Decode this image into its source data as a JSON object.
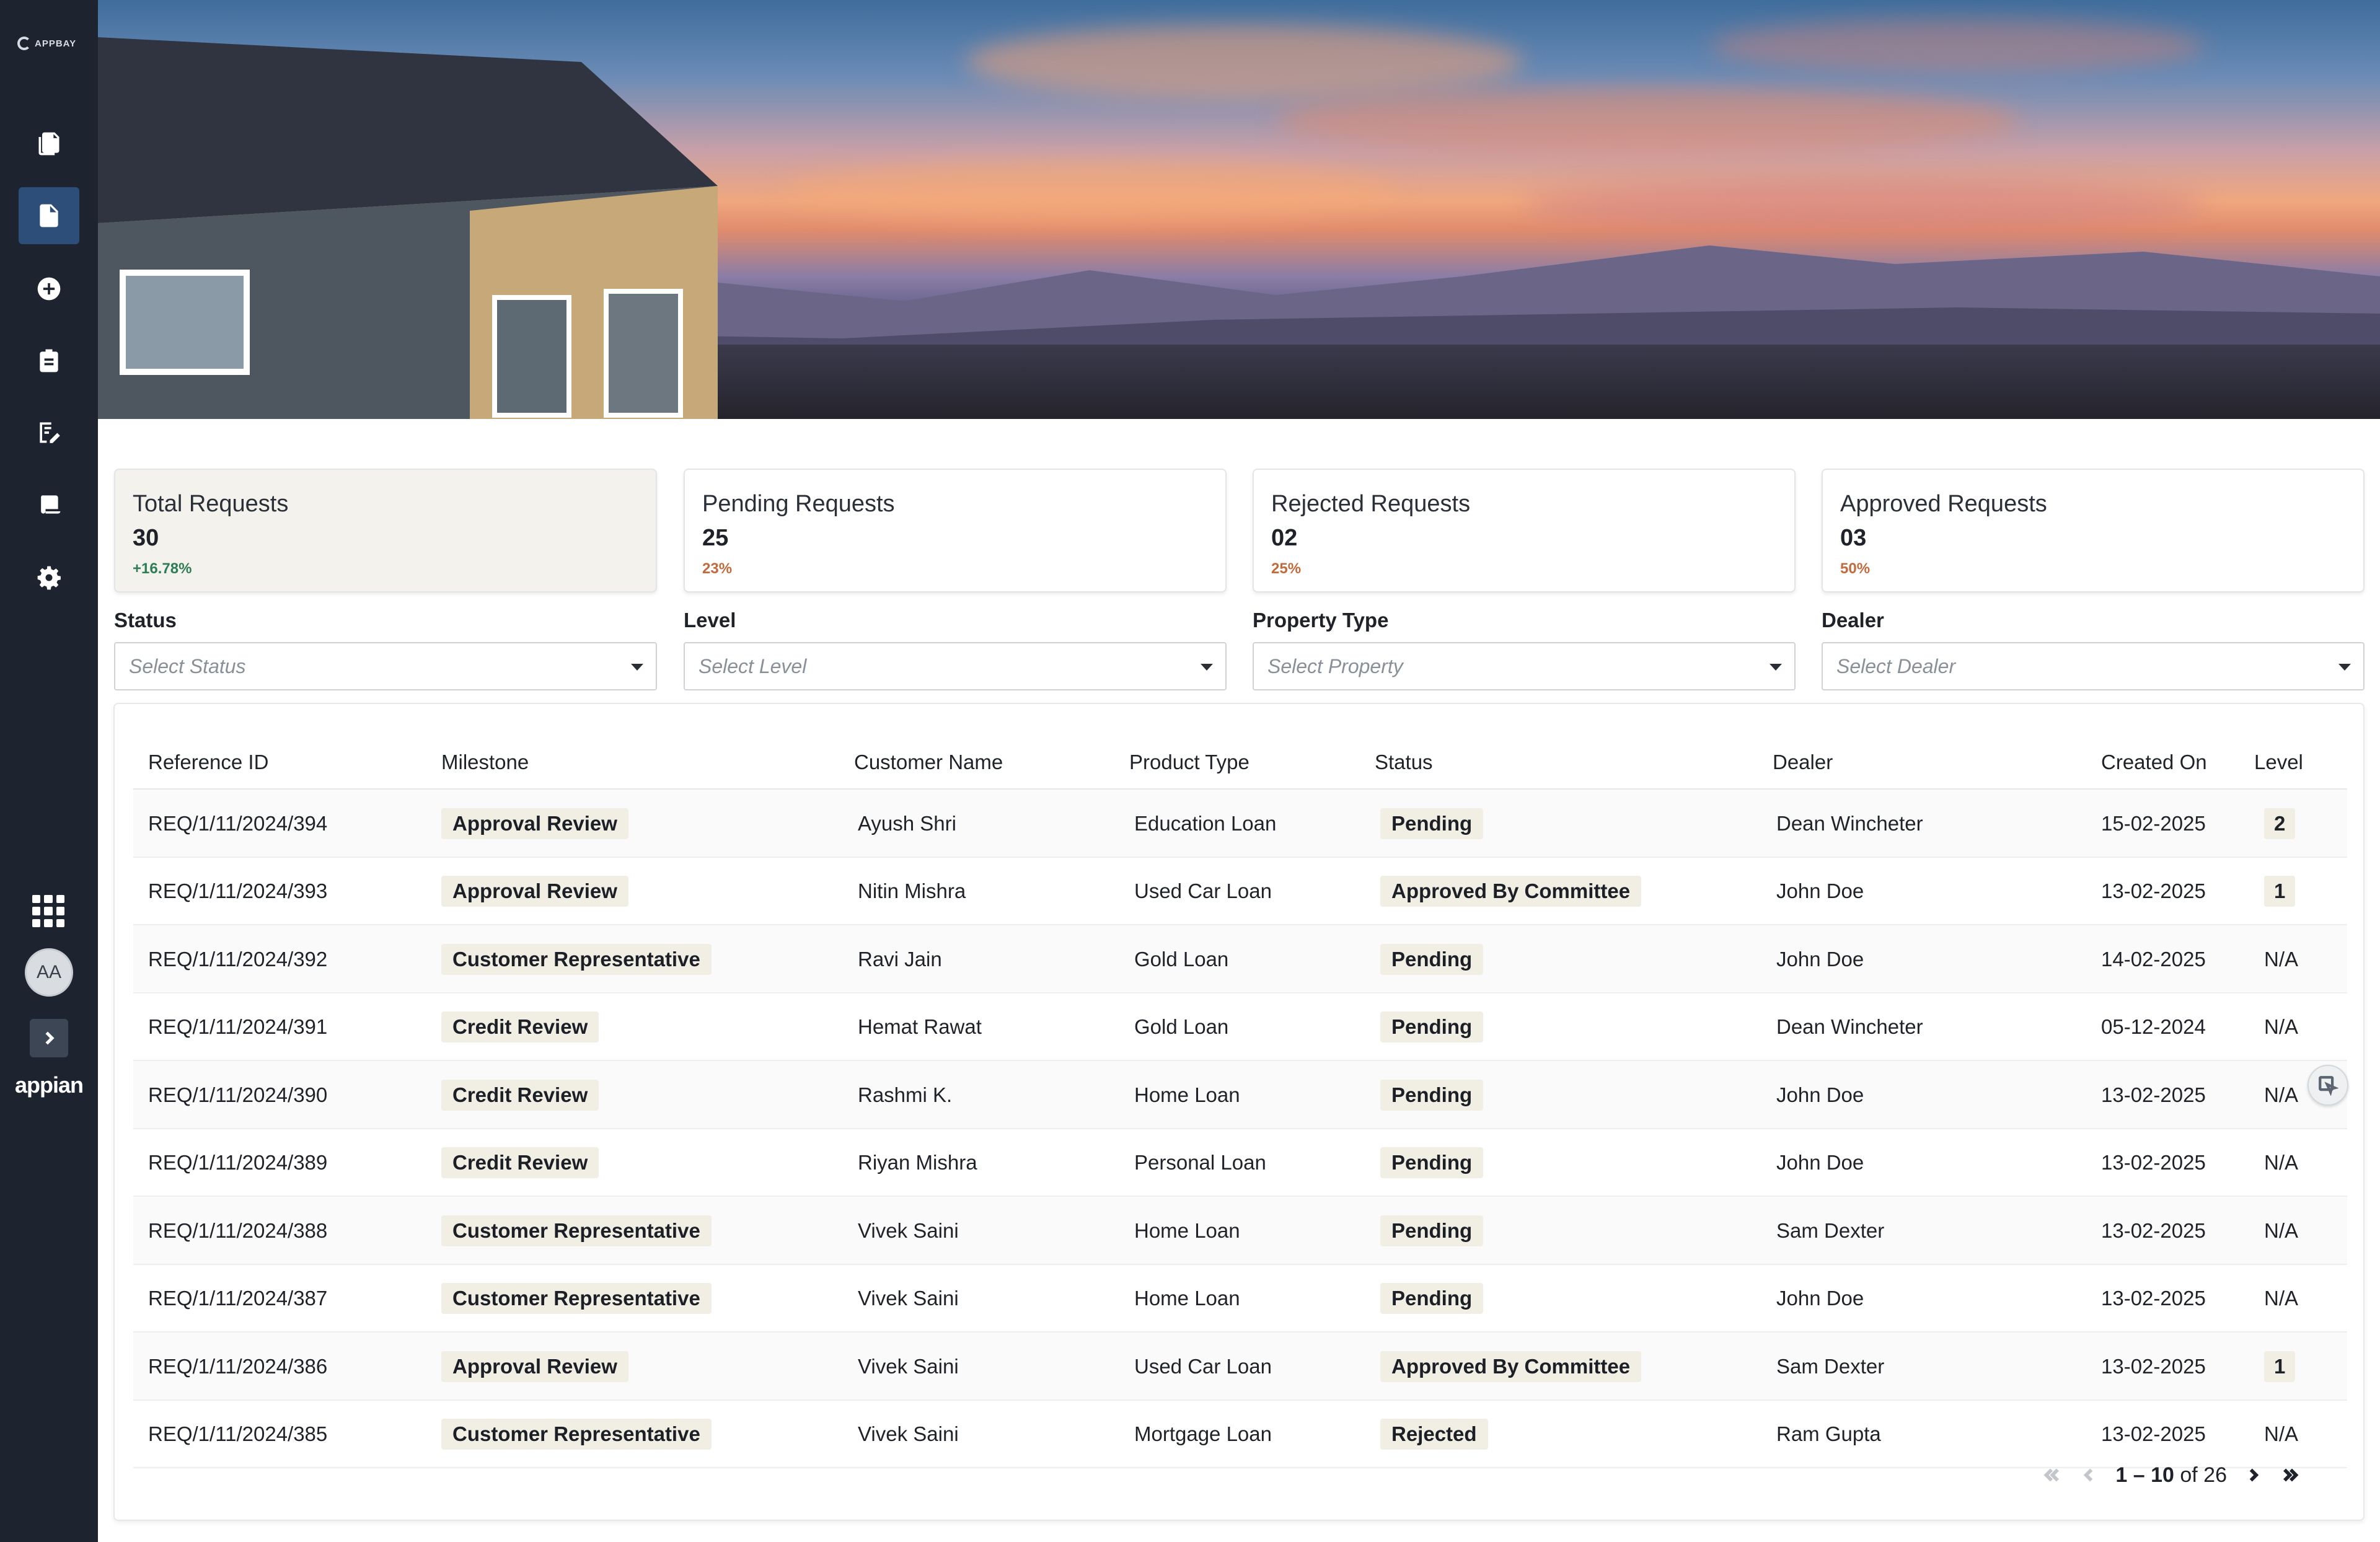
{
  "app": {
    "logo_text": "APPBAY",
    "brand": "appian",
    "avatar_initials": "AA"
  },
  "sidebar": {
    "items": [
      {
        "icon": "documents-icon",
        "active": false
      },
      {
        "icon": "document-icon",
        "active": true
      },
      {
        "icon": "add-circle-icon",
        "active": false
      },
      {
        "icon": "clipboard-icon",
        "active": false
      },
      {
        "icon": "report-edit-icon",
        "active": false
      },
      {
        "icon": "scroll-icon",
        "active": false
      },
      {
        "icon": "gear-icon",
        "active": false
      }
    ]
  },
  "cards": [
    {
      "label": "Total Requests",
      "value": "30",
      "delta": "+16.78%",
      "delta_color": "#2e7d55"
    },
    {
      "label": "Pending Requests",
      "value": "25",
      "delta": "23%",
      "delta_color": "#c26a3d"
    },
    {
      "label": "Rejected Requests",
      "value": "02",
      "delta": "25%",
      "delta_color": "#c26a3d"
    },
    {
      "label": "Approved Requests",
      "value": "03",
      "delta": "50%",
      "delta_color": "#c26a3d"
    }
  ],
  "filters": [
    {
      "label": "Status",
      "placeholder": "Select Status"
    },
    {
      "label": "Level",
      "placeholder": "Select Level"
    },
    {
      "label": "Property Type",
      "placeholder": "Select Property"
    },
    {
      "label": "Dealer",
      "placeholder": "Select Dealer"
    }
  ],
  "table": {
    "columns": [
      "Reference ID",
      "Milestone",
      "Customer Name",
      "Product Type",
      "Status",
      "Dealer",
      "Created On",
      "Level"
    ],
    "rows": [
      [
        "REQ/1/11/2024/394",
        "Approval Review",
        "Ayush Shri",
        "Education Loan",
        "Pending",
        "Dean Wincheter",
        "15-02-2025",
        "2"
      ],
      [
        "REQ/1/11/2024/393",
        "Approval Review",
        "Nitin Mishra",
        "Used Car Loan",
        "Approved By Committee",
        "John Doe",
        "13-02-2025",
        "1"
      ],
      [
        "REQ/1/11/2024/392",
        "Customer Representative",
        "Ravi Jain",
        "Gold Loan",
        "Pending",
        "John Doe",
        "14-02-2025",
        "N/A"
      ],
      [
        "REQ/1/11/2024/391",
        "Credit Review",
        "Hemat Rawat",
        "Gold Loan",
        "Pending",
        "Dean Wincheter",
        "05-12-2024",
        "N/A"
      ],
      [
        "REQ/1/11/2024/390",
        "Credit Review",
        "Rashmi K.",
        "Home Loan",
        "Pending",
        "John Doe",
        "13-02-2025",
        "N/A"
      ],
      [
        "REQ/1/11/2024/389",
        "Credit Review",
        "Riyan Mishra",
        "Personal Loan",
        "Pending",
        "John Doe",
        "13-02-2025",
        "N/A"
      ],
      [
        "REQ/1/11/2024/388",
        "Customer Representative",
        "Vivek Saini",
        "Home Loan",
        "Pending",
        "Sam Dexter",
        "13-02-2025",
        "N/A"
      ],
      [
        "REQ/1/11/2024/387",
        "Customer Representative",
        "Vivek Saini",
        "Home Loan",
        "Pending",
        "John Doe",
        "13-02-2025",
        "N/A"
      ],
      [
        "REQ/1/11/2024/386",
        "Approval Review",
        "Vivek Saini",
        "Used Car Loan",
        "Approved By Committee",
        "Sam Dexter",
        "13-02-2025",
        "1"
      ],
      [
        "REQ/1/11/2024/385",
        "Customer Representative",
        "Vivek Saini",
        "Mortgage Loan",
        "Rejected",
        "Ram Gupta",
        "13-02-2025",
        "N/A"
      ]
    ]
  },
  "pagination": {
    "range": "1 – 10",
    "of_text": "of 26"
  },
  "colors": {
    "sidebar_bg": "#1d2430",
    "active_nav": "#2d4e78",
    "pill_bg": "#f1efe4"
  }
}
